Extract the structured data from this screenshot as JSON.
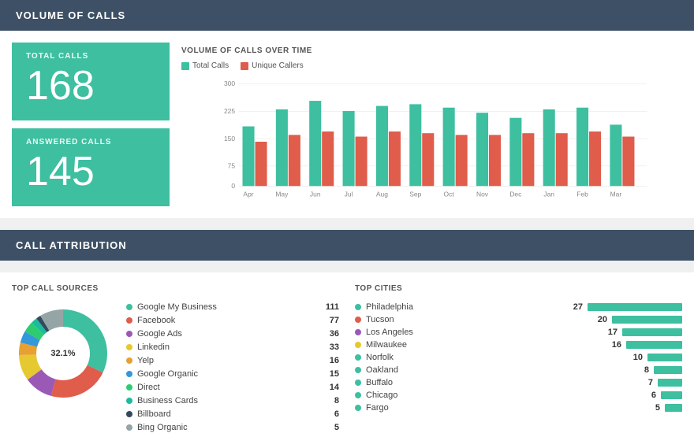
{
  "header1": {
    "title": "VOLUME OF CALLS"
  },
  "stats": {
    "total_calls_label": "TOTAL CALLS",
    "total_calls_value": "168",
    "answered_calls_label": "ANSWERED CALLS",
    "answered_calls_value": "145"
  },
  "volume_chart": {
    "title": "VOLUME OF CALLS OVER TIME",
    "legend": {
      "total_calls": "Total Calls",
      "unique_callers": "Unique Callers"
    },
    "y_labels": [
      "300",
      "225",
      "150",
      "75",
      "0"
    ],
    "months": [
      "Apr",
      "May",
      "Jun",
      "Jul",
      "Aug",
      "Sep",
      "Oct",
      "Nov",
      "Dec",
      "Jan",
      "Feb",
      "Mar"
    ],
    "total_values": [
      175,
      225,
      250,
      220,
      235,
      240,
      230,
      215,
      200,
      225,
      230,
      180
    ],
    "unique_values": [
      130,
      150,
      160,
      145,
      160,
      155,
      150,
      150,
      155,
      155,
      160,
      145
    ]
  },
  "header2": {
    "title": "CALL ATTRIBUTION"
  },
  "call_sources": {
    "subtitle": "TOP CALL SOURCES",
    "items": [
      {
        "name": "Google My Business",
        "count": 111,
        "color": "#3dbfa0",
        "percent": 32.1
      },
      {
        "name": "Facebook",
        "count": 77,
        "color": "#e05c4b",
        "percent": 22.3
      },
      {
        "name": "Google Ads",
        "count": 36,
        "color": "#9b59b6",
        "percent": 10.4
      },
      {
        "name": "Linkedin",
        "count": 33,
        "color": "#e6c830",
        "percent": 9.5
      },
      {
        "name": "Yelp",
        "count": 16,
        "color": "#e8a030",
        "percent": 4.6
      },
      {
        "name": "Google Organic",
        "count": 15,
        "color": "#3498db",
        "percent": 4.3
      },
      {
        "name": "Direct",
        "count": 14,
        "color": "#2ecc71",
        "percent": 4.0
      },
      {
        "name": "Business Cards",
        "count": 8,
        "color": "#1abc9c",
        "percent": 2.3
      },
      {
        "name": "Billboard",
        "count": 6,
        "color": "#34495e",
        "percent": 1.7
      },
      {
        "name": "Bing Organic",
        "count": 5,
        "color": "#95a5a6",
        "percent": 1.4
      }
    ],
    "donut_segments": [
      {
        "percent": 32.1,
        "color": "#3dbfa0"
      },
      {
        "percent": 22.3,
        "color": "#e05c4b"
      },
      {
        "percent": 10.4,
        "color": "#9b59b6"
      },
      {
        "percent": 9.5,
        "color": "#e6c830"
      },
      {
        "percent": 4.6,
        "color": "#e8a030"
      },
      {
        "percent": 4.3,
        "color": "#3498db"
      },
      {
        "percent": 4.0,
        "color": "#2ecc71"
      },
      {
        "percent": 2.3,
        "color": "#1abc9c"
      },
      {
        "percent": 1.7,
        "color": "#34495e"
      },
      {
        "percent": 8.8,
        "color": "#95a5a6"
      }
    ]
  },
  "top_cities": {
    "subtitle": "TOP CITIES",
    "max_value": 27,
    "items": [
      {
        "name": "Philadelphia",
        "count": 27,
        "color": "#3dbfa0"
      },
      {
        "name": "Tucson",
        "count": 20,
        "color": "#e05c4b"
      },
      {
        "name": "Los Angeles",
        "count": 17,
        "color": "#9b59b6"
      },
      {
        "name": "Milwaukee",
        "count": 16,
        "color": "#e6c830"
      },
      {
        "name": "Norfolk",
        "count": 10,
        "color": "#3dbfa0"
      },
      {
        "name": "Oakland",
        "count": 8,
        "color": "#3dbfa0"
      },
      {
        "name": "Buffalo",
        "count": 7,
        "color": "#3dbfa0"
      },
      {
        "name": "Chicago",
        "count": 6,
        "color": "#3dbfa0"
      },
      {
        "name": "Fargo",
        "count": 5,
        "color": "#3dbfa0"
      }
    ]
  }
}
